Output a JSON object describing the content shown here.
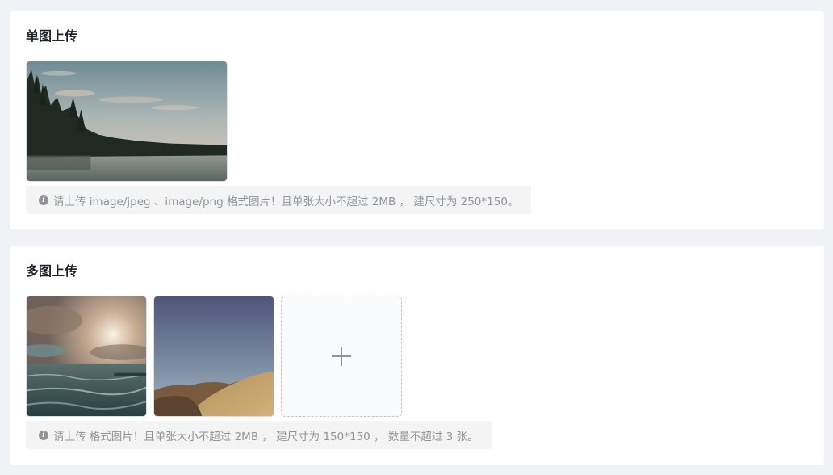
{
  "single": {
    "title": "单图上传",
    "tip": "请上传 image/jpeg 、image/png 格式图片！且单张大小不超过 2MB ， 建尺寸为 250*150。"
  },
  "multi": {
    "title": "多图上传",
    "tip": "请上传 格式图片！且单张大小不超过 2MB ， 建尺寸为 150*150 ， 数量不超过 3 张。",
    "images": [
      "ocean-sunset",
      "hills-sky"
    ]
  },
  "icons": {
    "info": "info-icon",
    "add": "plus-icon"
  },
  "colors": {
    "page_bg": "#f0f2f5",
    "card_bg": "#ffffff",
    "tip_bg": "#f4f4f5",
    "tip_text": "#909399"
  }
}
